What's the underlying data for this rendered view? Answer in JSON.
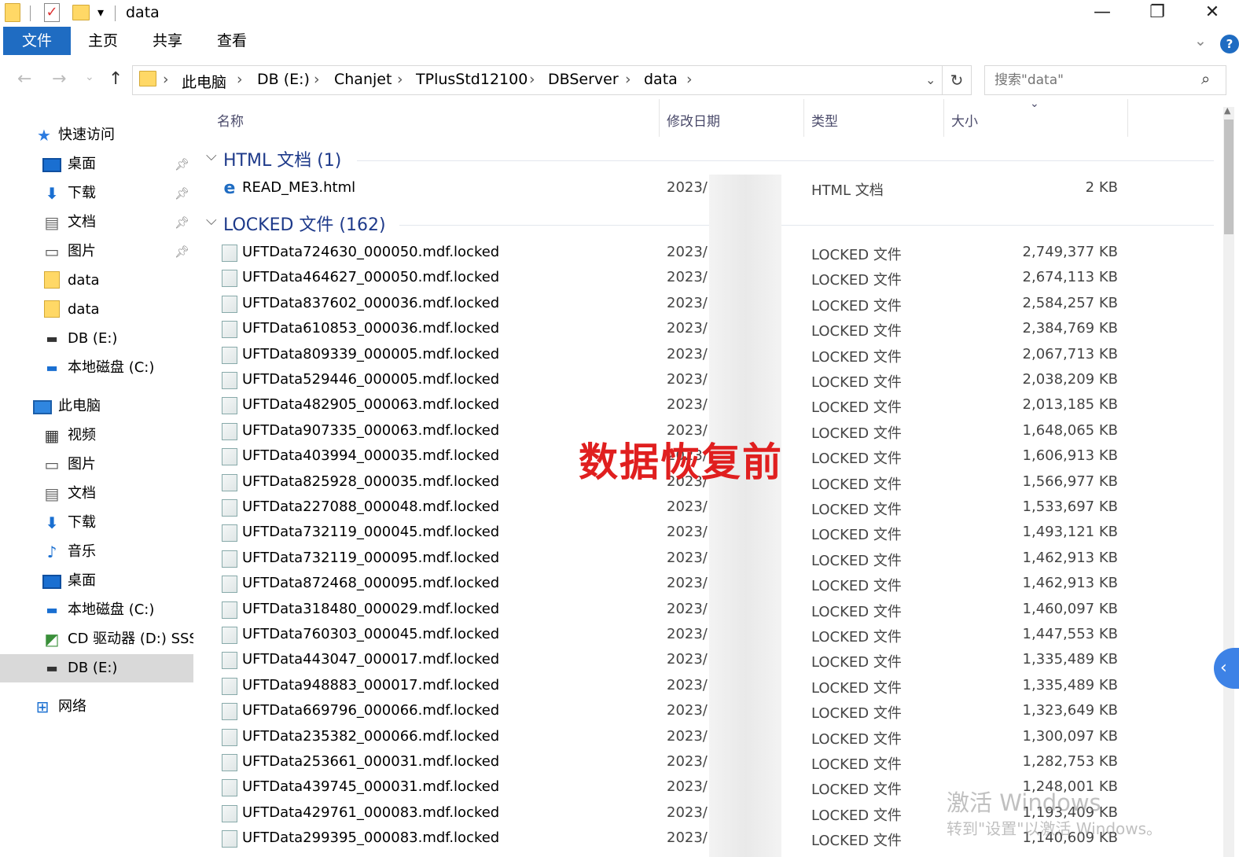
{
  "window": {
    "title": "data",
    "controls": {
      "minimize": "—",
      "restore": "❐",
      "close": "✕"
    }
  },
  "quick_access_toolbar": {
    "dropdown": "▾"
  },
  "ribbon": {
    "tabs": [
      "文件",
      "主页",
      "共享",
      "查看"
    ],
    "active_tab": "文件",
    "expand": "⌄",
    "help": "?"
  },
  "navigation": {
    "back": "←",
    "forward": "→",
    "recent": "⌄",
    "up": "↑",
    "breadcrumb": [
      "此电脑",
      "DB (E:)",
      "Chanjet",
      "TPlusStd12100",
      "DBServer",
      "data"
    ],
    "refresh": "↻",
    "search_placeholder": "搜索\"data\"",
    "search_icon": "⌕"
  },
  "sidebar": {
    "items": [
      {
        "label": "快速访问",
        "icon": "star-icon",
        "pinned": false
      },
      {
        "label": "桌面",
        "icon": "desktop-icon",
        "pinned": true
      },
      {
        "label": "下载",
        "icon": "download-icon",
        "pinned": true
      },
      {
        "label": "文档",
        "icon": "document-icon",
        "pinned": true
      },
      {
        "label": "图片",
        "icon": "picture-icon",
        "pinned": true
      },
      {
        "label": "data",
        "icon": "folder-icon",
        "pinned": false
      },
      {
        "label": "data",
        "icon": "folder-icon",
        "pinned": false
      },
      {
        "label": "DB (E:)",
        "icon": "drive-icon",
        "pinned": false
      },
      {
        "label": "本地磁盘 (C:)",
        "icon": "local-disk-icon",
        "pinned": false
      },
      {
        "label": "此电脑",
        "icon": "computer-icon",
        "pinned": false
      },
      {
        "label": "视频",
        "icon": "video-icon",
        "pinned": false
      },
      {
        "label": "图片",
        "icon": "picture-icon",
        "pinned": false
      },
      {
        "label": "文档",
        "icon": "document-icon",
        "pinned": false
      },
      {
        "label": "下载",
        "icon": "download-icon",
        "pinned": false
      },
      {
        "label": "音乐",
        "icon": "music-icon",
        "pinned": false
      },
      {
        "label": "桌面",
        "icon": "desktop-icon",
        "pinned": false
      },
      {
        "label": "本地磁盘 (C:)",
        "icon": "local-disk-icon",
        "pinned": false
      },
      {
        "label": "CD 驱动器 (D:) SSS",
        "icon": "cd-drive-icon",
        "pinned": false
      },
      {
        "label": "DB (E:)",
        "icon": "drive-icon",
        "pinned": false,
        "selected": true
      },
      {
        "label": "网络",
        "icon": "network-icon",
        "pinned": false
      }
    ]
  },
  "columns": {
    "name": "名称",
    "modified": "修改日期",
    "type": "类型",
    "size": "大小",
    "sort_arrow": "⌄"
  },
  "groups": [
    {
      "title": "HTML 文档 (1)",
      "files": [
        {
          "name": "READ_ME3.html",
          "date": "2023/",
          "type": "HTML 文档",
          "size": "2 KB",
          "icon": "ie-icon"
        }
      ]
    },
    {
      "title": "LOCKED 文件 (162)",
      "files": [
        {
          "name": "UFTData724630_000050.mdf.locked",
          "date": "2023/",
          "type": "LOCKED 文件",
          "size": "2,749,377 KB"
        },
        {
          "name": "UFTData464627_000050.mdf.locked",
          "date": "2023/",
          "type": "LOCKED 文件",
          "size": "2,674,113 KB"
        },
        {
          "name": "UFTData837602_000036.mdf.locked",
          "date": "2023/",
          "type": "LOCKED 文件",
          "size": "2,584,257 KB"
        },
        {
          "name": "UFTData610853_000036.mdf.locked",
          "date": "2023/",
          "type": "LOCKED 文件",
          "size": "2,384,769 KB"
        },
        {
          "name": "UFTData809339_000005.mdf.locked",
          "date": "2023/",
          "type": "LOCKED 文件",
          "size": "2,067,713 KB"
        },
        {
          "name": "UFTData529446_000005.mdf.locked",
          "date": "2023/",
          "type": "LOCKED 文件",
          "size": "2,038,209 KB"
        },
        {
          "name": "UFTData482905_000063.mdf.locked",
          "date": "2023/",
          "type": "LOCKED 文件",
          "size": "2,013,185 KB"
        },
        {
          "name": "UFTData907335_000063.mdf.locked",
          "date": "2023/",
          "type": "LOCKED 文件",
          "size": "1,648,065 KB"
        },
        {
          "name": "UFTData403994_000035.mdf.locked",
          "date": "2023/",
          "type": "LOCKED 文件",
          "size": "1,606,913 KB"
        },
        {
          "name": "UFTData825928_000035.mdf.locked",
          "date": "2023/",
          "type": "LOCKED 文件",
          "size": "1,566,977 KB"
        },
        {
          "name": "UFTData227088_000048.mdf.locked",
          "date": "2023/",
          "type": "LOCKED 文件",
          "size": "1,533,697 KB"
        },
        {
          "name": "UFTData732119_000045.mdf.locked",
          "date": "2023/",
          "type": "LOCKED 文件",
          "size": "1,493,121 KB"
        },
        {
          "name": "UFTData732119_000095.mdf.locked",
          "date": "2023/",
          "type": "LOCKED 文件",
          "size": "1,462,913 KB"
        },
        {
          "name": "UFTData872468_000095.mdf.locked",
          "date": "2023/",
          "type": "LOCKED 文件",
          "size": "1,462,913 KB"
        },
        {
          "name": "UFTData318480_000029.mdf.locked",
          "date": "2023/",
          "type": "LOCKED 文件",
          "size": "1,460,097 KB"
        },
        {
          "name": "UFTData760303_000045.mdf.locked",
          "date": "2023/",
          "type": "LOCKED 文件",
          "size": "1,447,553 KB"
        },
        {
          "name": "UFTData443047_000017.mdf.locked",
          "date": "2023/",
          "type": "LOCKED 文件",
          "size": "1,335,489 KB"
        },
        {
          "name": "UFTData948883_000017.mdf.locked",
          "date": "2023/",
          "type": "LOCKED 文件",
          "size": "1,335,489 KB"
        },
        {
          "name": "UFTData669796_000066.mdf.locked",
          "date": "2023/",
          "type": "LOCKED 文件",
          "size": "1,323,649 KB"
        },
        {
          "name": "UFTData235382_000066.mdf.locked",
          "date": "2023/",
          "type": "LOCKED 文件",
          "size": "1,300,097 KB"
        },
        {
          "name": "UFTData253661_000031.mdf.locked",
          "date": "2023/",
          "type": "LOCKED 文件",
          "size": "1,282,753 KB"
        },
        {
          "name": "UFTData439745_000031.mdf.locked",
          "date": "2023/",
          "type": "LOCKED 文件",
          "size": "1,248,001 KB"
        },
        {
          "name": "UFTData429761_000083.mdf.locked",
          "date": "2023/",
          "type": "LOCKED 文件",
          "size": "1,193,409 KB"
        },
        {
          "name": "UFTData299395_000083.mdf.locked",
          "date": "2023/",
          "type": "LOCKED 文件",
          "size": "1,140,609 KB"
        }
      ]
    }
  ],
  "overlay_text": "数据恢复前",
  "watermark": {
    "line1": "激活 Windows",
    "line2": "转到\"设置\"以激活 Windows。"
  },
  "colors": {
    "accent": "#1f6cc2",
    "overlay": "#e01f1f",
    "group_title": "#1e3a8a"
  }
}
